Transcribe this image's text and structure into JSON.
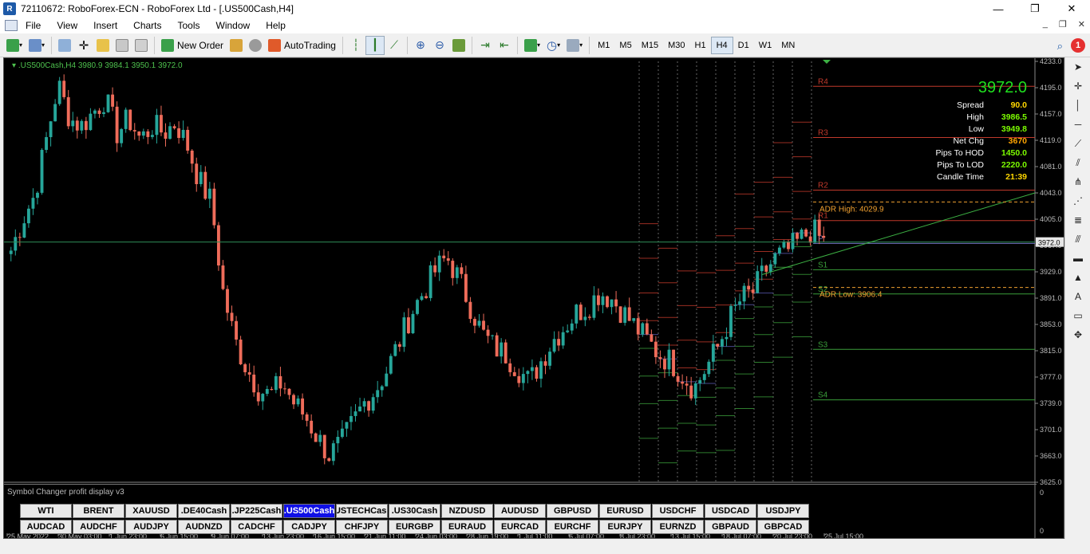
{
  "window": {
    "title": "72110672: RoboForex-ECN - RoboForex Ltd - [.US500Cash,H4]",
    "controls": [
      "—",
      "❐",
      "✕"
    ]
  },
  "menu": {
    "items": [
      "File",
      "View",
      "Insert",
      "Charts",
      "Tools",
      "Window",
      "Help"
    ],
    "mdi_controls": [
      "_",
      "❐",
      "✕"
    ]
  },
  "toolbar": {
    "new_order_label": "New Order",
    "autotrading_label": "AutoTrading",
    "timeframes": [
      "M1",
      "M5",
      "M15",
      "M30",
      "H1",
      "H4",
      "D1",
      "W1",
      "MN"
    ],
    "active_timeframe": "H4",
    "notification_count": "1"
  },
  "chart": {
    "header": ".US500Cash,H4  3980.9 3984.1 3950.1 3972.0",
    "big_price": "3972.0",
    "info": [
      {
        "label": "Spread",
        "value": "90.0",
        "color": "#ffd700"
      },
      {
        "label": "High",
        "value": "3986.5",
        "color": "#7cfc00"
      },
      {
        "label": "Low",
        "value": "3949.8",
        "color": "#7cfc00"
      },
      {
        "label": "Net Chg",
        "value": "3670",
        "color": "#ffa500"
      },
      {
        "label": "Pips To HOD",
        "value": "1450.0",
        "color": "#7cfc00"
      },
      {
        "label": "Pips To LOD",
        "value": "2220.0",
        "color": "#7cfc00"
      },
      {
        "label": "Candle Time",
        "value": "21:39",
        "color": "#ffd700"
      }
    ],
    "price_axis": [
      "4233.0",
      "4195.0",
      "4157.0",
      "4119.0",
      "4081.0",
      "4043.0",
      "4005.0",
      "3967.0",
      "3929.0",
      "3891.0",
      "3853.0",
      "3815.0",
      "3777.0",
      "3739.0",
      "3701.0",
      "3663.0",
      "3625.0"
    ],
    "current_price_tag": "3972.0",
    "pivot_labels": [
      "R4",
      "R3",
      "R2",
      "R1",
      "P",
      "S1",
      "S2",
      "S3",
      "S4"
    ],
    "adr_high_label": "ADR High: 4029.9",
    "adr_low_label": "ADR Low: 3906.4",
    "time_axis": [
      "25 May 2022",
      "30 May 03:00",
      "1 Jun 23:00",
      "6 Jun 15:00",
      "9 Jun 07:00",
      "13 Jun 23:00",
      "16 Jun 15:00",
      "21 Jun 11:00",
      "24 Jun 03:00",
      "28 Jun 19:00",
      "1 Jul 11:00",
      "6 Jul 07:00",
      "8 Jul 23:00",
      "13 Jul 15:00",
      "18 Jul 07:00",
      "20 Jul 23:00",
      "25 Jul 15:00"
    ],
    "colors": {
      "bull": "#26a69a",
      "bear": "#ef6c5a",
      "bid_line": "#2e8b57",
      "trend": "#3cb043",
      "adr": "#f0a030",
      "resistance": "#c0392b",
      "support": "#3a9d3a"
    }
  },
  "symbol_changer": {
    "title": "Symbol Changer profit display v3",
    "subaxis_labels": [
      "0",
      "0"
    ],
    "row1": [
      "WTI",
      "BRENT",
      "XAUUSD",
      ".DE40Cash",
      ".JP225Cash",
      ".US500Cash",
      ".USTECHCash",
      ".US30Cash",
      "NZDUSD",
      "AUDUSD",
      "GBPUSD",
      "EURUSD",
      "USDCHF",
      "USDCAD",
      "USDJPY"
    ],
    "row2": [
      "AUDCAD",
      "AUDCHF",
      "AUDJPY",
      "AUDNZD",
      "CADCHF",
      "CADJPY",
      "CHFJPY",
      "EURGBP",
      "EURAUD",
      "EURCAD",
      "EURCHF",
      "EURJPY",
      "EURNZD",
      "GBPAUD",
      "GBPCAD"
    ],
    "active": ".US500Cash"
  },
  "chart_data": {
    "type": "candlestick",
    "ylim": [
      3625,
      4233
    ],
    "current_price": 3972.0,
    "pivots": {
      "R4": 4197,
      "R3": 4123,
      "R2": 4047,
      "R1": 4003,
      "P": 3970,
      "S1": 3932,
      "S2": 3897,
      "S3": 3817,
      "S4": 3744
    },
    "adr_high": 4029.9,
    "adr_low": 3906.4,
    "close_path": [
      3960,
      4005,
      4040,
      4120,
      4200,
      4150,
      4140,
      4160,
      4180,
      4130,
      4150,
      4120,
      4140,
      4130,
      4145,
      4110,
      4060,
      4030,
      3900,
      3830,
      3790,
      3760,
      3750,
      3770,
      3740,
      3720,
      3690,
      3665,
      3680,
      3710,
      3740,
      3760,
      3790,
      3830,
      3870,
      3900,
      3930,
      3950,
      3920,
      3880,
      3840,
      3820,
      3810,
      3790,
      3770,
      3800,
      3830,
      3850,
      3870,
      3880,
      3900,
      3890,
      3870,
      3850,
      3830,
      3810,
      3800,
      3780,
      3760,
      3790,
      3820,
      3860,
      3890,
      3900,
      3930,
      3950,
      3960,
      3975,
      3990,
      3972
    ]
  }
}
